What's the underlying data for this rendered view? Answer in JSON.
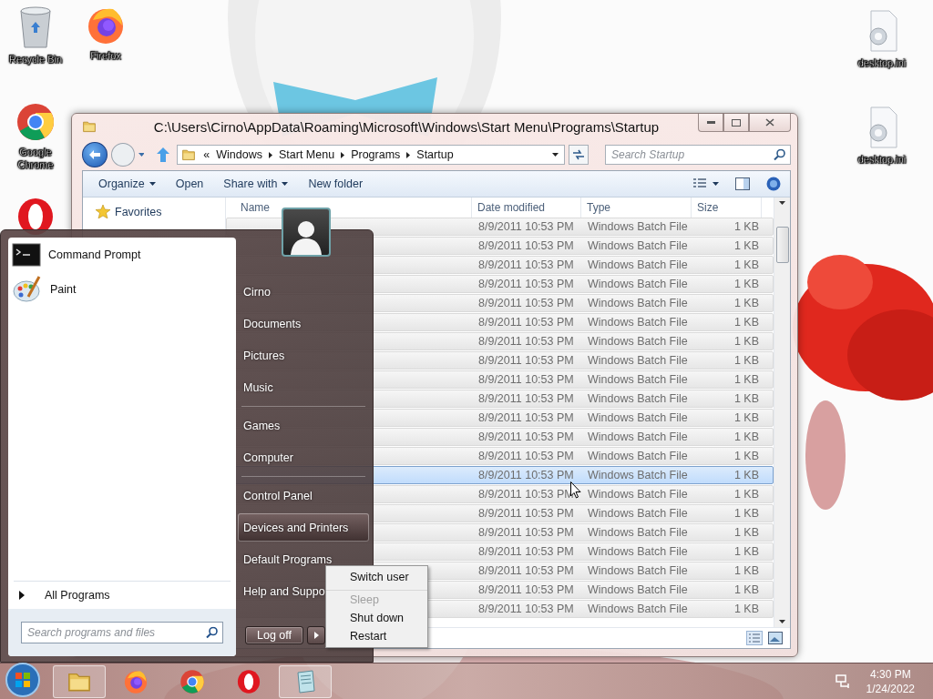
{
  "desktop": {
    "icons": [
      {
        "kind": "recycle-bin",
        "label": "Recycle Bin"
      },
      {
        "kind": "firefox",
        "label": "Firefox"
      },
      {
        "kind": "chrome",
        "label": "Google Chrome"
      },
      {
        "kind": "opera"
      },
      {
        "kind": "settings-file",
        "label": "desktop.ini"
      },
      {
        "kind": "settings-file",
        "label": "desktop.ini"
      }
    ]
  },
  "explorer": {
    "title": "C:\\Users\\Cirno\\AppData\\Roaming\\Microsoft\\Windows\\Start Menu\\Programs\\Startup",
    "breadcrumb_overflow": "«",
    "breadcrumb": [
      "Windows",
      "Start Menu",
      "Programs",
      "Startup"
    ],
    "search": {
      "placeholder": "Search Startup"
    },
    "toolbar": [
      {
        "label": "Organize",
        "dropdown": true
      },
      {
        "label": "Open",
        "dropdown": false
      },
      {
        "label": "Share with",
        "dropdown": true
      },
      {
        "label": "New folder",
        "dropdown": false
      }
    ],
    "nav": [
      {
        "label": "Favorites"
      }
    ],
    "columns": [
      "Name",
      "Date modified",
      "Type",
      "Size"
    ],
    "rows": [
      {
        "date": "8/9/2011 10:53 PM",
        "type": "Windows Batch File",
        "size": "1 KB",
        "selected": false
      },
      {
        "date": "8/9/2011 10:53 PM",
        "type": "Windows Batch File",
        "size": "1 KB",
        "selected": false
      },
      {
        "date": "8/9/2011 10:53 PM",
        "type": "Windows Batch File",
        "size": "1 KB",
        "selected": false
      },
      {
        "date": "8/9/2011 10:53 PM",
        "type": "Windows Batch File",
        "size": "1 KB",
        "selected": false
      },
      {
        "date": "8/9/2011 10:53 PM",
        "type": "Windows Batch File",
        "size": "1 KB",
        "selected": false
      },
      {
        "date": "8/9/2011 10:53 PM",
        "type": "Windows Batch File",
        "size": "1 KB",
        "selected": false
      },
      {
        "date": "8/9/2011 10:53 PM",
        "type": "Windows Batch File",
        "size": "1 KB",
        "selected": false
      },
      {
        "date": "8/9/2011 10:53 PM",
        "type": "Windows Batch File",
        "size": "1 KB",
        "selected": false
      },
      {
        "date": "8/9/2011 10:53 PM",
        "type": "Windows Batch File",
        "size": "1 KB",
        "selected": false
      },
      {
        "date": "8/9/2011 10:53 PM",
        "type": "Windows Batch File",
        "size": "1 KB",
        "selected": false
      },
      {
        "date": "8/9/2011 10:53 PM",
        "type": "Windows Batch File",
        "size": "1 KB",
        "selected": false
      },
      {
        "date": "8/9/2011 10:53 PM",
        "type": "Windows Batch File",
        "size": "1 KB",
        "selected": false
      },
      {
        "date": "8/9/2011 10:53 PM",
        "type": "Windows Batch File",
        "size": "1 KB",
        "selected": false
      },
      {
        "date": "8/9/2011 10:53 PM",
        "type": "Windows Batch File",
        "size": "1 KB",
        "selected": true
      },
      {
        "date": "8/9/2011 10:53 PM",
        "type": "Windows Batch File",
        "size": "1 KB",
        "selected": false
      },
      {
        "date": "8/9/2011 10:53 PM",
        "type": "Windows Batch File",
        "size": "1 KB",
        "selected": false
      },
      {
        "date": "8/9/2011 10:53 PM",
        "type": "Windows Batch File",
        "size": "1 KB",
        "selected": false
      },
      {
        "date": "8/9/2011 10:53 PM",
        "type": "Windows Batch File",
        "size": "1 KB",
        "selected": false
      },
      {
        "date": "8/9/2011 10:53 PM",
        "type": "Windows Batch File",
        "size": "1 KB",
        "selected": false
      },
      {
        "date": "8/9/2011 10:53 PM",
        "type": "Windows Batch File",
        "size": "1 KB",
        "selected": false
      },
      {
        "date": "8/9/2011 10:53 PM",
        "type": "Windows Batch File",
        "size": "1 KB",
        "selected": false
      }
    ]
  },
  "start_menu": {
    "programs": [
      {
        "kind": "terminal",
        "label": "Command Prompt"
      },
      {
        "kind": "palette",
        "label": "Paint"
      }
    ],
    "all_programs": "All Programs",
    "search": {
      "placeholder": "Search programs and files"
    },
    "place_groups": [
      [
        {
          "label": "Cirno",
          "selected": false
        },
        {
          "label": "Documents",
          "selected": false
        },
        {
          "label": "Pictures",
          "selected": false
        },
        {
          "label": "Music",
          "selected": false
        }
      ],
      [
        {
          "label": "Games",
          "selected": false
        },
        {
          "label": "Computer",
          "selected": false
        }
      ],
      [
        {
          "label": "Control Panel",
          "selected": false
        },
        {
          "label": "Devices and Printers",
          "selected": true
        },
        {
          "label": "Default Programs",
          "selected": false
        },
        {
          "label": "Help and Suppo",
          "selected": false
        }
      ]
    ],
    "power_button": "Log off",
    "power_menu": [
      {
        "label": "Switch user",
        "disabled": false
      },
      {
        "label": "Sleep",
        "disabled": true
      },
      {
        "label": "Shut down",
        "disabled": false
      },
      {
        "label": "Restart",
        "disabled": false
      }
    ]
  },
  "taskbar": {
    "apps": [
      {
        "kind": "folder",
        "active": true
      },
      {
        "kind": "firefox",
        "active": false
      },
      {
        "kind": "chrome",
        "active": false
      },
      {
        "kind": "opera",
        "active": false
      },
      {
        "kind": "notepad",
        "active": true
      }
    ],
    "time": "4:30 PM",
    "date": "1/24/2022"
  }
}
